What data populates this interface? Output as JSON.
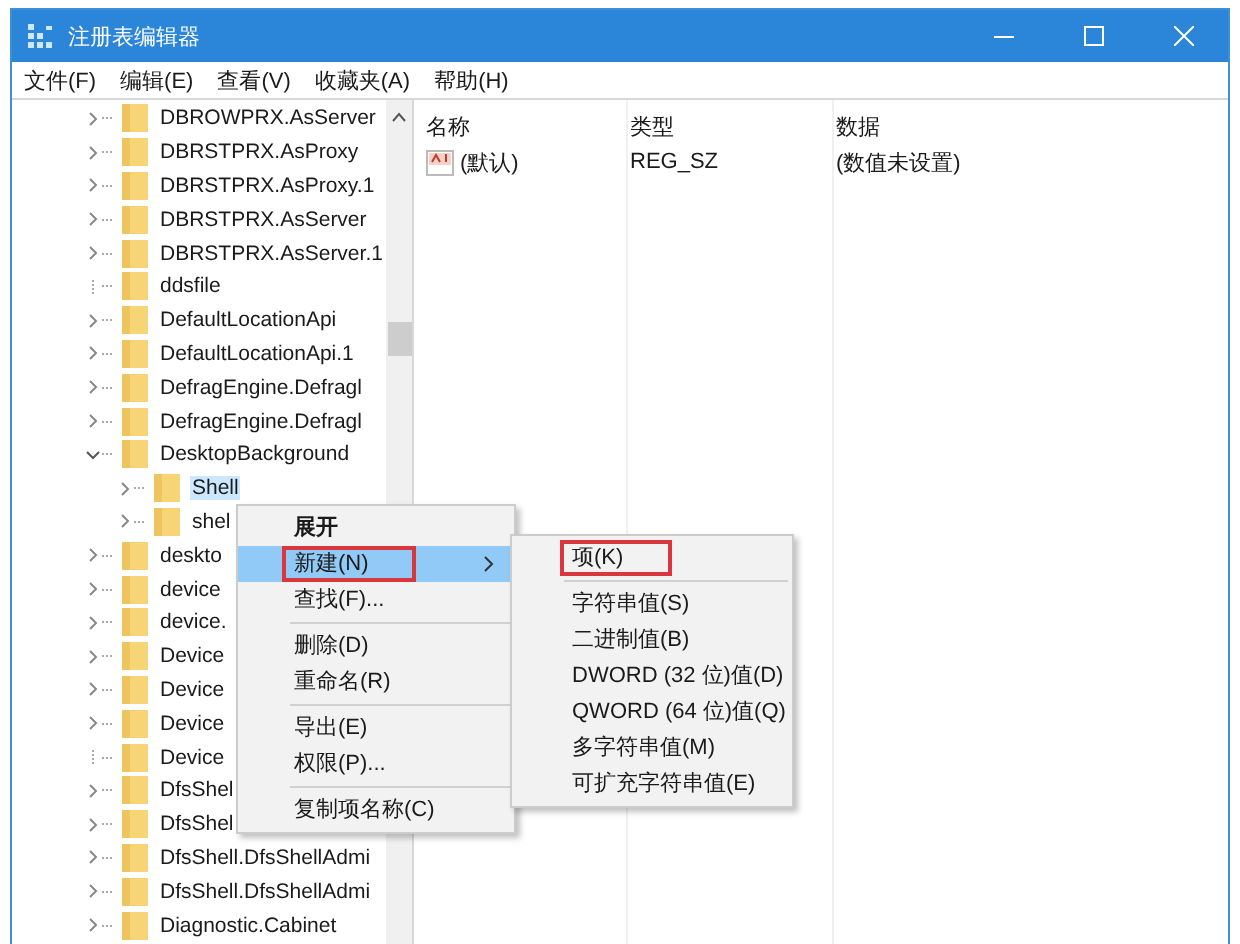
{
  "window": {
    "title": "注册表编辑器"
  },
  "menu_bar": [
    "文件(F)",
    "编辑(E)",
    "查看(V)",
    "收藏夹(A)",
    "帮助(H)"
  ],
  "tree": {
    "items": [
      {
        "label": "DBROWPRX.AsServer",
        "expandable": true,
        "expanded": false,
        "selected": false
      },
      {
        "label": "DBRSTPRX.AsProxy",
        "expandable": true,
        "expanded": false,
        "selected": false
      },
      {
        "label": "DBRSTPRX.AsProxy.1",
        "expandable": true,
        "expanded": false,
        "selected": false
      },
      {
        "label": "DBRSTPRX.AsServer",
        "expandable": true,
        "expanded": false,
        "selected": false
      },
      {
        "label": "DBRSTPRX.AsServer.1",
        "expandable": true,
        "expanded": false,
        "selected": false
      },
      {
        "label": "ddsfile",
        "expandable": false,
        "selected": false
      },
      {
        "label": "DefaultLocationApi",
        "expandable": true,
        "expanded": false,
        "selected": false
      },
      {
        "label": "DefaultLocationApi.1",
        "expandable": true,
        "expanded": false,
        "selected": false
      },
      {
        "label": "DefragEngine.Defragl",
        "expandable": true,
        "expanded": false,
        "selected": false
      },
      {
        "label": "DefragEngine.Defragl",
        "expandable": true,
        "expanded": false,
        "selected": false
      },
      {
        "label": "DesktopBackground",
        "expandable": true,
        "expanded": true,
        "selected": false,
        "children": [
          {
            "label": "Shell",
            "expandable": true,
            "expanded": false,
            "selected": true
          },
          {
            "label": "shel",
            "expandable": true,
            "expanded": false,
            "selected": false
          }
        ]
      },
      {
        "label": "deskto",
        "expandable": true,
        "expanded": false,
        "selected": false
      },
      {
        "label": "device",
        "expandable": true,
        "expanded": false,
        "selected": false
      },
      {
        "label": "device.",
        "expandable": true,
        "expanded": false,
        "selected": false
      },
      {
        "label": "Device",
        "expandable": true,
        "expanded": false,
        "selected": false
      },
      {
        "label": "Device",
        "expandable": true,
        "expanded": false,
        "selected": false
      },
      {
        "label": "Device",
        "expandable": true,
        "expanded": false,
        "selected": false
      },
      {
        "label": "Device",
        "expandable": false,
        "selected": false
      },
      {
        "label": "DfsShel",
        "expandable": true,
        "expanded": false,
        "selected": false
      },
      {
        "label": "DfsShel",
        "expandable": true,
        "expanded": false,
        "selected": false
      },
      {
        "label": "DfsShell.DfsShellAdmi",
        "expandable": true,
        "expanded": false,
        "selected": false
      },
      {
        "label": "DfsShell.DfsShellAdmi",
        "expandable": true,
        "expanded": false,
        "selected": false
      },
      {
        "label": "Diagnostic.Cabinet",
        "expandable": true,
        "expanded": false,
        "selected": false
      }
    ]
  },
  "values_table": {
    "columns": [
      "名称",
      "类型",
      "数据"
    ],
    "rows": [
      {
        "name": "(默认)",
        "type": "REG_SZ",
        "data": "(数值未设置)"
      }
    ]
  },
  "context_menu": {
    "items": [
      {
        "kind": "item",
        "label": "展开",
        "bold": true,
        "selected": false,
        "highlighted": false,
        "submenu": false
      },
      {
        "kind": "item",
        "label": "新建(N)",
        "bold": false,
        "selected": true,
        "highlighted": true,
        "submenu": true
      },
      {
        "kind": "item",
        "label": "查找(F)...",
        "bold": false,
        "selected": false,
        "highlighted": false,
        "submenu": false
      },
      {
        "kind": "separator"
      },
      {
        "kind": "item",
        "label": "删除(D)",
        "bold": false,
        "selected": false,
        "highlighted": false,
        "submenu": false
      },
      {
        "kind": "item",
        "label": "重命名(R)",
        "bold": false,
        "selected": false,
        "highlighted": false,
        "submenu": false
      },
      {
        "kind": "separator"
      },
      {
        "kind": "item",
        "label": "导出(E)",
        "bold": false,
        "selected": false,
        "highlighted": false,
        "submenu": false
      },
      {
        "kind": "item",
        "label": "权限(P)...",
        "bold": false,
        "selected": false,
        "highlighted": false,
        "submenu": false
      },
      {
        "kind": "separator"
      },
      {
        "kind": "item",
        "label": "复制项名称(C)",
        "bold": false,
        "selected": false,
        "highlighted": false,
        "submenu": false
      }
    ]
  },
  "submenu": {
    "items": [
      {
        "kind": "item",
        "label": "项(K)",
        "highlighted": true
      },
      {
        "kind": "separator"
      },
      {
        "kind": "item",
        "label": "字符串值(S)",
        "highlighted": false
      },
      {
        "kind": "item",
        "label": "二进制值(B)",
        "highlighted": false
      },
      {
        "kind": "item",
        "label": "DWORD (32 位)值(D)",
        "highlighted": false
      },
      {
        "kind": "item",
        "label": "QWORD (64 位)值(Q)",
        "highlighted": false
      },
      {
        "kind": "item",
        "label": "多字符串值(M)",
        "highlighted": false
      },
      {
        "kind": "item",
        "label": "可扩充字符串值(E)",
        "highlighted": false
      }
    ]
  }
}
